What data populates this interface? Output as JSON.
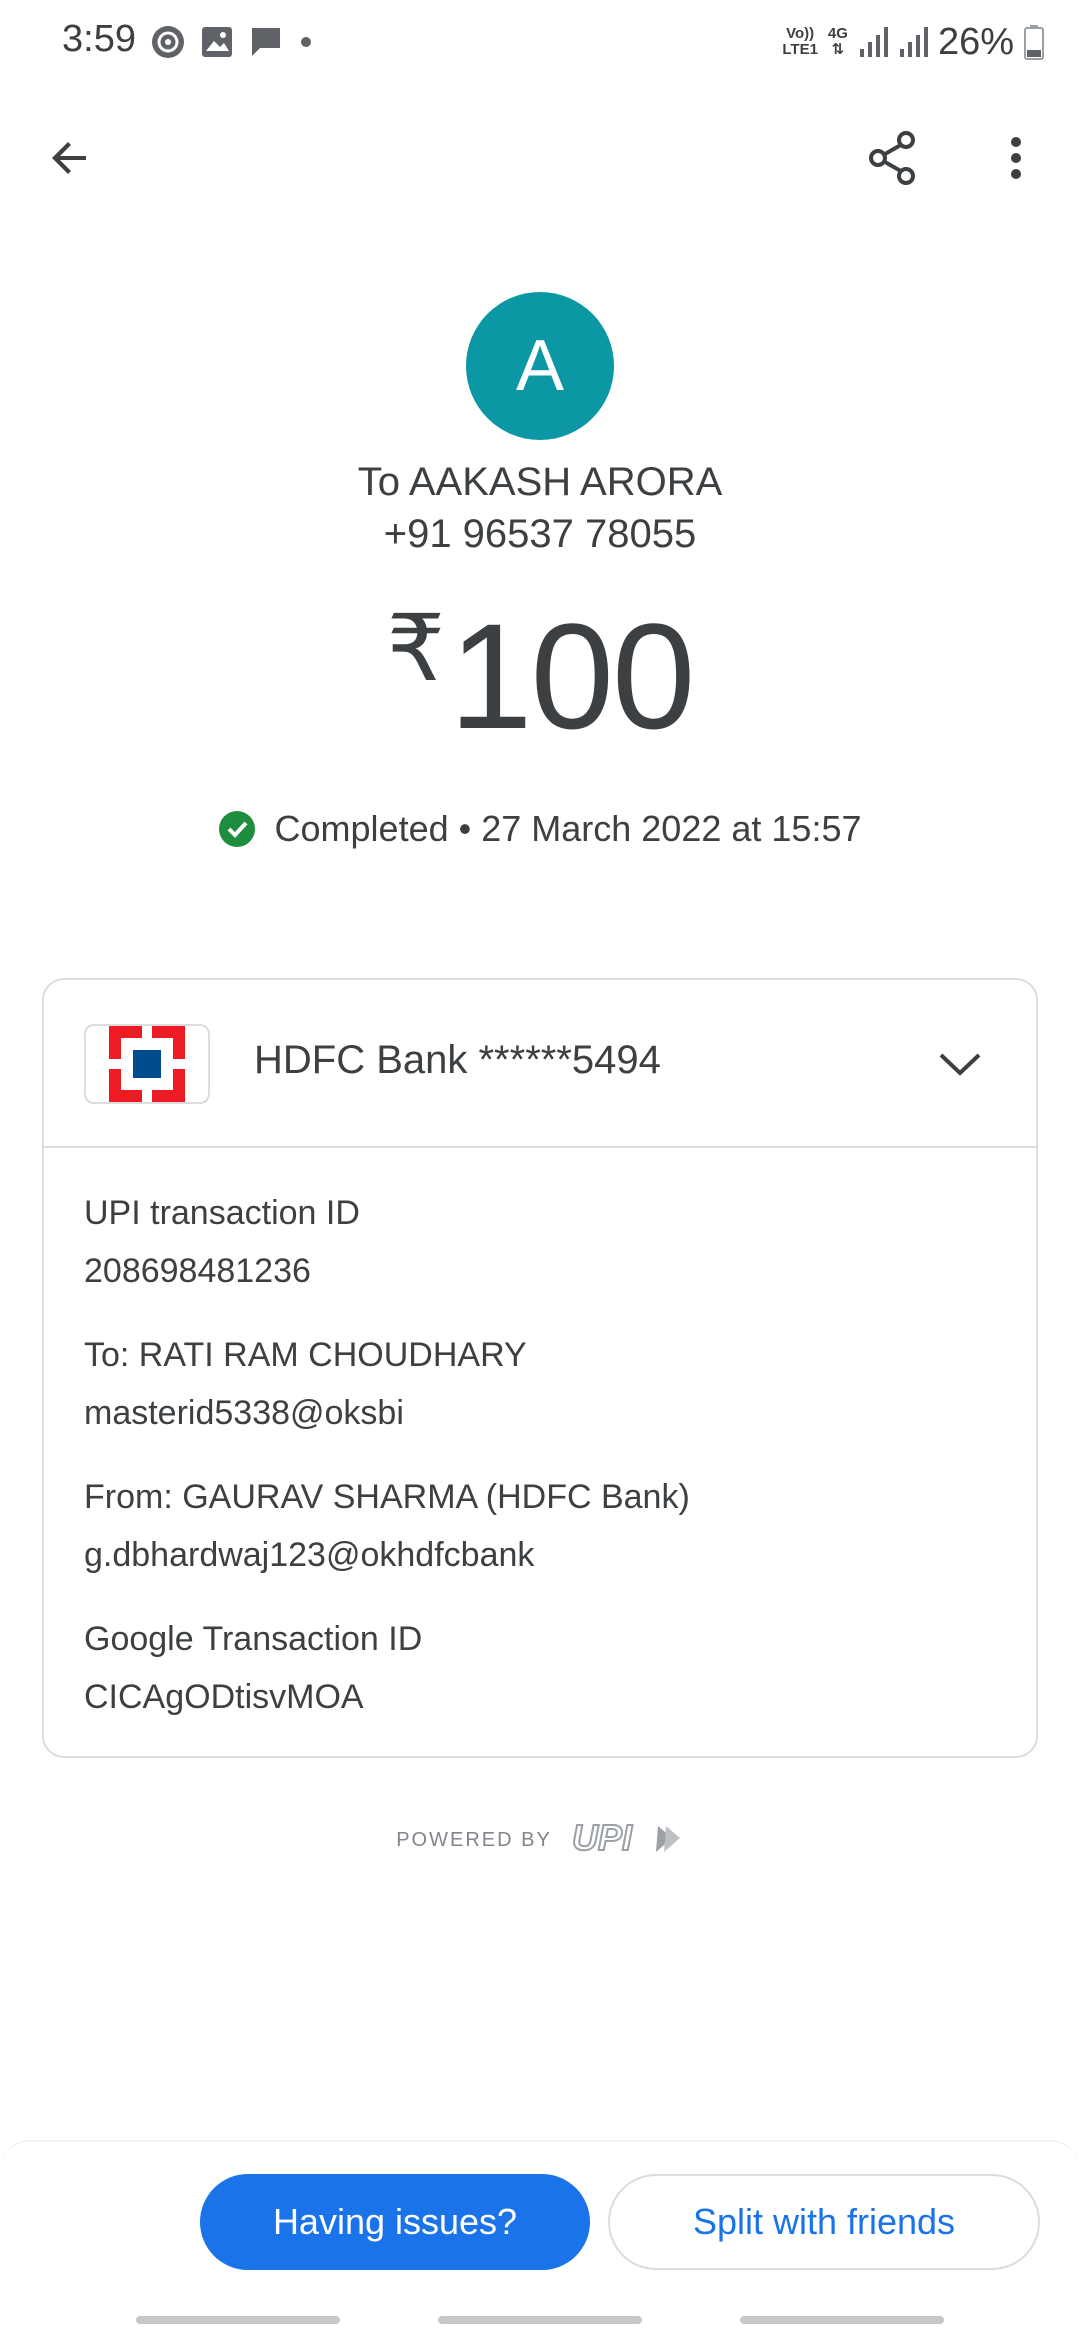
{
  "status_bar": {
    "time": "3:59",
    "network_top": "Vo))",
    "network_bottom": "LTE1",
    "network_type": "4G",
    "battery": "26%"
  },
  "recipient": {
    "avatar_letter": "A",
    "avatar_color": "#0b97a4",
    "name": "To AAKASH ARORA",
    "phone": "+91 96537 78055"
  },
  "amount": {
    "currency": "₹",
    "value": "100"
  },
  "status": {
    "text": "Completed • 27 March 2022 at 15:57",
    "color": "#1e8e3e"
  },
  "card": {
    "bank_label": "HDFC Bank ******5494",
    "details": [
      {
        "label": "UPI transaction ID",
        "value": "208698481236"
      },
      {
        "label": "To: RATI RAM  CHOUDHARY",
        "value": "masterid5338@oksbi"
      },
      {
        "label": "From: GAURAV SHARMA (HDFC Bank)",
        "value": "g.dbhardwaj123@okhdfcbank"
      },
      {
        "label": "Google Transaction ID",
        "value": "CICAgODtisvMOA"
      }
    ]
  },
  "footer": {
    "powered_by": "POWERED BY",
    "upi_logo": "UPI"
  },
  "actions": {
    "issues_label": "Having issues?",
    "split_label": "Split with friends",
    "primary_color": "#1a73e8"
  }
}
